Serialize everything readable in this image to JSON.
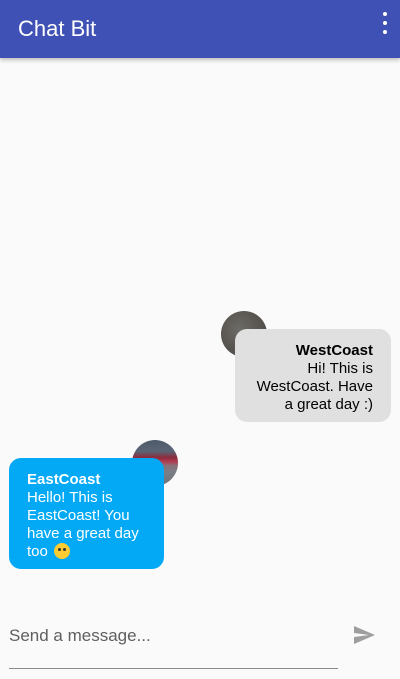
{
  "appbar": {
    "title": "Chat Bit"
  },
  "messages": [
    {
      "sender": "WestCoast",
      "text": "Hi! This is WestCoast. Have a great day :)",
      "side": "right"
    },
    {
      "sender": "EastCoast",
      "text": "Hello! This is EastCoast! You have a great day too",
      "side": "left",
      "emoji": "smiling-face-emoji"
    }
  ],
  "composer": {
    "placeholder": "Send a message...",
    "value": ""
  },
  "icons": {
    "menu": "more-vert-icon",
    "send": "send-icon"
  },
  "colors": {
    "appbar": "#3f51b5",
    "own_bubble": "#e0e0e0",
    "other_bubble": "#03a9f4",
    "background": "#fafafa"
  }
}
